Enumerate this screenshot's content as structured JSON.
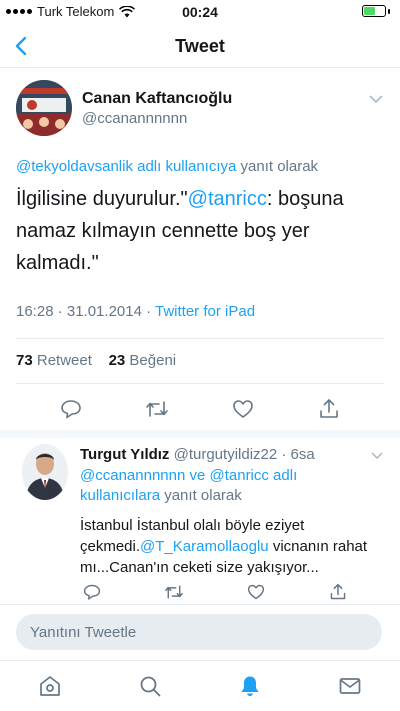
{
  "status_bar": {
    "carrier": "Turk Telekom",
    "time": "00:24",
    "battery_level": 0.6,
    "colors": {
      "battery": "#4cd964"
    }
  },
  "header": {
    "title": "Tweet",
    "back_icon": "chevron-left-icon"
  },
  "tweet": {
    "author_name": "Canan Kaftancıoğlu",
    "author_handle": "@ccanannnnnn",
    "reply_to_mention": "@tekyoldavsanlik adlı kullanıcıya",
    "reply_to_suffix": " yanıt olarak",
    "text_before": "İlgilisine duyurulur.\"",
    "text_mention": "@tanricc",
    "text_after": ": boşuna namaz kılmayın cennette boş yer kalmadı.\"",
    "date_time": "16:28 · 31.01.2014 · ",
    "source": "Twitter for iPad",
    "retweets_count": "73",
    "retweets_label": "Retweet",
    "likes_count": "23",
    "likes_label": "Beğeni"
  },
  "reply": {
    "author_name": "Turgut Yıldız",
    "author_handle": "@turgutyildiz22",
    "time_ago": "· 6sa",
    "reply_to_mentions": "@ccanannnnnn ve @tanricc adlı kullanıcılara",
    "reply_to_suffix": " yanıt olarak",
    "text_before": "İstanbul İstanbul olalı böyle eziyet çekmedi.",
    "text_mention": "@T_Karamollaoglu",
    "text_after": " vicnanın rahat mı...Canan'ın ceketi size yakışıyor..."
  },
  "compose": {
    "placeholder": "Yanıtını Tweetle"
  },
  "tabs": [
    {
      "icon": "home-icon"
    },
    {
      "icon": "search-icon"
    },
    {
      "icon": "notifications-bell-icon",
      "active": true
    },
    {
      "icon": "messages-envelope-icon"
    }
  ],
  "colors": {
    "accent": "#1da1f2",
    "muted": "#657786",
    "text": "#14171a"
  }
}
